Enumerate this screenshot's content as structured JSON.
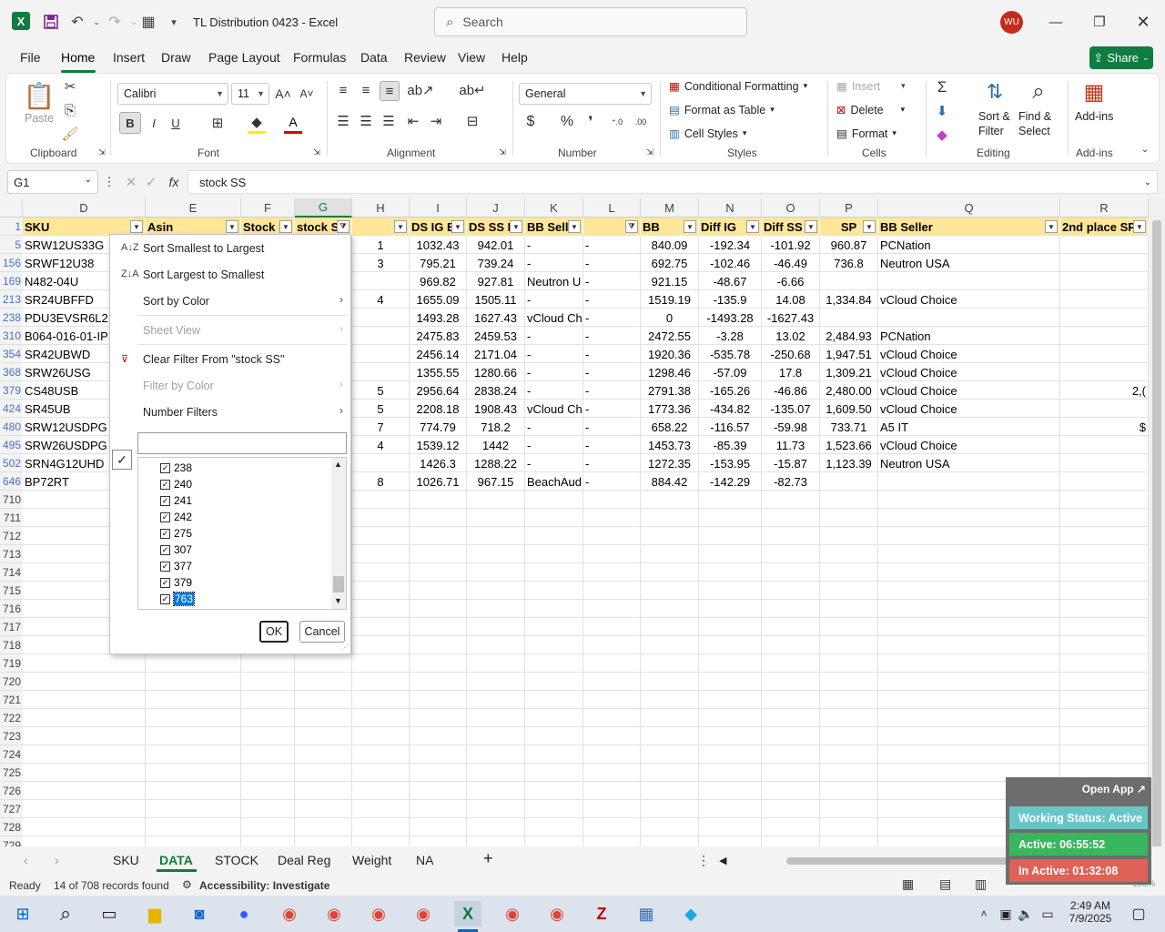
{
  "window": {
    "title": "TL Distribution 0423  -  Excel",
    "search_placeholder": "Search",
    "user_initials": "WU"
  },
  "menu": [
    "File",
    "Home",
    "Insert",
    "Draw",
    "Page Layout",
    "Formulas",
    "Data",
    "Review",
    "View",
    "Help"
  ],
  "share_label": "Share",
  "ribbon": {
    "clipboard": {
      "label": "Clipboard",
      "paste": "Paste"
    },
    "font": {
      "label": "Font",
      "name": "Calibri",
      "size": "11"
    },
    "alignment": {
      "label": "Alignment"
    },
    "number": {
      "label": "Number",
      "format": "General"
    },
    "styles": {
      "label": "Styles",
      "cond": "Conditional Formatting",
      "table": "Format as Table",
      "cell": "Cell Styles"
    },
    "cells": {
      "label": "Cells",
      "insert": "Insert",
      "delete": "Delete",
      "format": "Format"
    },
    "editing": {
      "label": "Editing",
      "sort": "Sort &",
      "filter": "Filter",
      "find": "Find &",
      "select": "Select"
    },
    "addins": {
      "label": "Add-ins",
      "btn": "Add-ins"
    }
  },
  "formula": {
    "namebox": "G1",
    "content": "stock SS"
  },
  "columns": [
    "D",
    "E",
    "F",
    "G",
    "H",
    "I",
    "J",
    "K",
    "L",
    "M",
    "N",
    "O",
    "P",
    "Q",
    "R"
  ],
  "header_row": {
    "num": "1",
    "cells": [
      "SKU",
      "Asin",
      "Stock I",
      "stock S",
      "",
      "DS IG B",
      "DS SS B",
      "BB Selle",
      "",
      "BB",
      "Diff IG",
      "Diff SS",
      "SP",
      "BB Seller",
      "2nd place SP"
    ]
  },
  "rows": [
    {
      "num": "5",
      "d": "SRW12US33G",
      "h": "1",
      "i": "1032.43",
      "j": "942.01",
      "k": "-",
      "l": "-",
      "m": "840.09",
      "n": "-192.34",
      "o": "-101.92",
      "p": "960.87",
      "q": "PCNation",
      "r": ""
    },
    {
      "num": "156",
      "d": "SRWF12U38",
      "h": "3",
      "i": "795.21",
      "j": "739.24",
      "k": "-",
      "l": "-",
      "m": "692.75",
      "n": "-102.46",
      "o": "-46.49",
      "p": "736.8",
      "q": "Neutron USA",
      "r": ""
    },
    {
      "num": "169",
      "d": "N482-04U",
      "h": "",
      "i": "969.82",
      "j": "927.81",
      "k": "Neutron U",
      "l": "-",
      "m": "921.15",
      "n": "-48.67",
      "o": "-6.66",
      "p": "",
      "q": "",
      "r": ""
    },
    {
      "num": "213",
      "d": "SR24UBFFD",
      "h": "4",
      "i": "1655.09",
      "j": "1505.11",
      "k": "-",
      "l": "-",
      "m": "1519.19",
      "n": "-135.9",
      "o": "14.08",
      "p": "1,334.84",
      "q": "vCloud Choice",
      "r": ""
    },
    {
      "num": "238",
      "d": "PDU3EVSR6L21",
      "h": "",
      "i": "1493.28",
      "j": "1627.43",
      "k": "vCloud Ch",
      "l": "-",
      "m": "0",
      "n": "-1493.28",
      "o": "-1627.43",
      "p": "",
      "q": "",
      "r": ""
    },
    {
      "num": "310",
      "d": "B064-016-01-IP",
      "h": "",
      "i": "2475.83",
      "j": "2459.53",
      "k": "-",
      "l": "-",
      "m": "2472.55",
      "n": "-3.28",
      "o": "13.02",
      "p": "2,484.93",
      "q": "PCNation",
      "r": ""
    },
    {
      "num": "354",
      "d": "SR42UBWD",
      "h": "",
      "i": "2456.14",
      "j": "2171.04",
      "k": "-",
      "l": "-",
      "m": "1920.36",
      "n": "-535.78",
      "o": "-250.68",
      "p": "1,947.51",
      "q": "vCloud Choice",
      "r": ""
    },
    {
      "num": "368",
      "d": "SRW26USG",
      "h": "",
      "i": "1355.55",
      "j": "1280.66",
      "k": "-",
      "l": "-",
      "m": "1298.46",
      "n": "-57.09",
      "o": "17.8",
      "p": "1,309.21",
      "q": "vCloud Choice",
      "r": ""
    },
    {
      "num": "379",
      "d": "CS48USB",
      "h": "5",
      "i": "2956.64",
      "j": "2838.24",
      "k": "-",
      "l": "-",
      "m": "2791.38",
      "n": "-165.26",
      "o": "-46.86",
      "p": "2,480.00",
      "q": "vCloud Choice",
      "r": "2,("
    },
    {
      "num": "424",
      "d": "SR45UB",
      "h": "5",
      "i": "2208.18",
      "j": "1908.43",
      "k": "vCloud Ch",
      "l": "-",
      "m": "1773.36",
      "n": "-434.82",
      "o": "-135.07",
      "p": "1,609.50",
      "q": "vCloud Choice",
      "r": ""
    },
    {
      "num": "480",
      "d": "SRW12USDPG",
      "h": "7",
      "i": "774.79",
      "j": "718.2",
      "k": "-",
      "l": "-",
      "m": "658.22",
      "n": "-116.57",
      "o": "-59.98",
      "p": "733.71",
      "q": "A5 IT",
      "r": "$"
    },
    {
      "num": "495",
      "d": "SRW26USDPG",
      "h": "4",
      "i": "1539.12",
      "j": "1442",
      "k": "-",
      "l": "-",
      "m": "1453.73",
      "n": "-85.39",
      "o": "11.73",
      "p": "1,523.66",
      "q": "vCloud Choice",
      "r": ""
    },
    {
      "num": "502",
      "d": "SRN4G12UHD",
      "h": "",
      "i": "1426.3",
      "j": "1288.22",
      "k": "-",
      "l": "-",
      "m": "1272.35",
      "n": "-153.95",
      "o": "-15.87",
      "p": "1,123.39",
      "q": "Neutron USA",
      "r": ""
    },
    {
      "num": "646",
      "d": "BP72RT",
      "h": "8",
      "i": "1026.71",
      "j": "967.15",
      "k": "BeachAud",
      "l": "-",
      "m": "884.42",
      "n": "-142.29",
      "o": "-82.73",
      "p": "",
      "q": "",
      "r": ""
    }
  ],
  "empty_rows": [
    "710",
    "711",
    "712",
    "713",
    "714",
    "715",
    "716",
    "717",
    "718",
    "719",
    "720",
    "721",
    "722",
    "723",
    "724",
    "725",
    "726",
    "727",
    "728",
    "729"
  ],
  "filter_menu": {
    "sort_asc": "Sort Smallest to Largest",
    "sort_desc": "Sort Largest to Smallest",
    "sort_color": "Sort by Color",
    "sheet_view": "Sheet View",
    "clear": "Clear Filter From \"stock SS\"",
    "filter_color": "Filter by Color",
    "number_filters": "Number Filters",
    "values": [
      "238",
      "240",
      "241",
      "242",
      "275",
      "307",
      "377",
      "379",
      "763"
    ],
    "ok": "OK",
    "cancel": "Cancel"
  },
  "sheets": [
    "SKU",
    "DATA",
    "STOCK",
    "Deal Reg",
    "Weight",
    "NA"
  ],
  "active_sheet": "DATA",
  "status": {
    "ready": "Ready",
    "records": "14 of 708 records found",
    "accessibility": "Accessibility: Investigate",
    "zoom": "100%"
  },
  "overlay": {
    "open_app": "Open App ↗",
    "working": "Working Status: Active",
    "active": "Active: 06:55:52",
    "inactive": "In Active: 01:32:08"
  },
  "clock": {
    "time": "2:49 AM",
    "date": "7/9/2025"
  },
  "colors": {
    "excel_green": "#107c41",
    "header_fill": "#ffe699",
    "row_blue": "#4472c4",
    "overlay_teal": "#5fc5c5",
    "overlay_green": "#2fb457",
    "overlay_red": "#e05a50"
  }
}
